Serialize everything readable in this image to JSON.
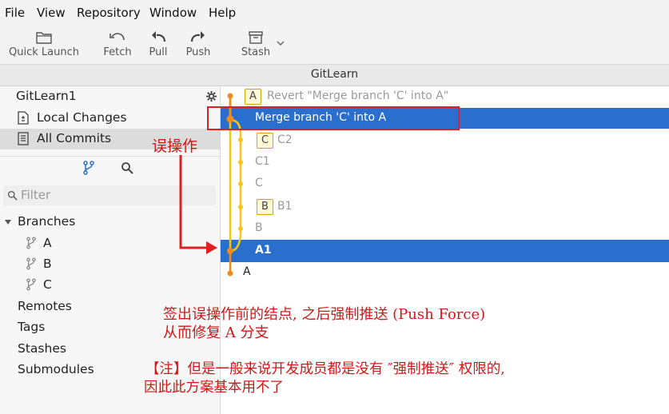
{
  "menu": [
    "File",
    "View",
    "Repository",
    "Window",
    "Help"
  ],
  "toolbar": {
    "quick_launch": "Quick Launch",
    "fetch": "Fetch",
    "pull": "Pull",
    "push": "Push",
    "stash": "Stash"
  },
  "window_title": "GitLearn",
  "sidebar": {
    "repo_name": "GitLearn1",
    "local_changes": "Local Changes",
    "all_commits": "All Commits",
    "filter_placeholder": "Filter",
    "branches_header": "Branches",
    "branches": [
      "A",
      "B",
      "C"
    ],
    "remotes": "Remotes",
    "tags": "Tags",
    "stashes": "Stashes",
    "submodules": "Submodules"
  },
  "commits": [
    {
      "tag": "A",
      "message": "Revert \"Merge branch 'C' into A\""
    },
    {
      "tag": "",
      "message": "Merge branch 'C' into A"
    },
    {
      "tag": "C",
      "message": "C2"
    },
    {
      "tag": "",
      "message": "C1"
    },
    {
      "tag": "",
      "message": "C"
    },
    {
      "tag": "B",
      "message": "B1"
    },
    {
      "tag": "",
      "message": "B"
    },
    {
      "tag": "",
      "message": "A1"
    },
    {
      "tag": "",
      "message": "A"
    }
  ],
  "annotations": {
    "mistake": "误操作",
    "line1": "签出误操作前的结点, 之后强制推送 (Push Force)",
    "line2": "从而修复 A 分支",
    "note1": "【注】但是一般来说开发成员都是没有 ″强制推送″ 权限的,",
    "note2": "因此此方案基本用不了"
  },
  "colors": {
    "selection": "#2b6fce",
    "graph_line": "#f5c518",
    "graph_node": "#f08c1a",
    "annotation": "#d01818"
  }
}
